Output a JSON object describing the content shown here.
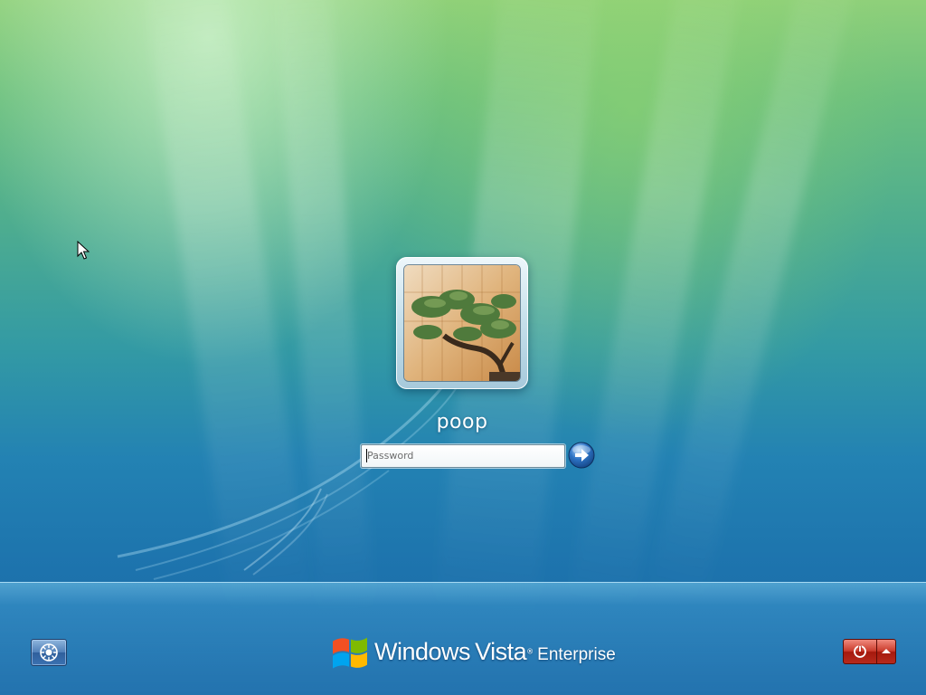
{
  "login": {
    "username": "poop",
    "password_placeholder": "Password",
    "password_value": ""
  },
  "branding": {
    "windows": "Windows",
    "vista": "Vista",
    "trademark": "®",
    "edition": "Enterprise"
  },
  "icons": {
    "avatar": "bonsai-tree-picture",
    "submit": "right-arrow-icon",
    "accessibility": "ease-of-access-icon",
    "power": "power-icon",
    "power_menu": "chevron-up-icon",
    "pointer": "mouse-cursor-icon"
  },
  "colors": {
    "background_top": "#8fd07a",
    "background_bottom": "#1f6da6",
    "power_red": "#c93a2b",
    "access_blue": "#3b72b2",
    "go_blue": "#2d74c6"
  }
}
